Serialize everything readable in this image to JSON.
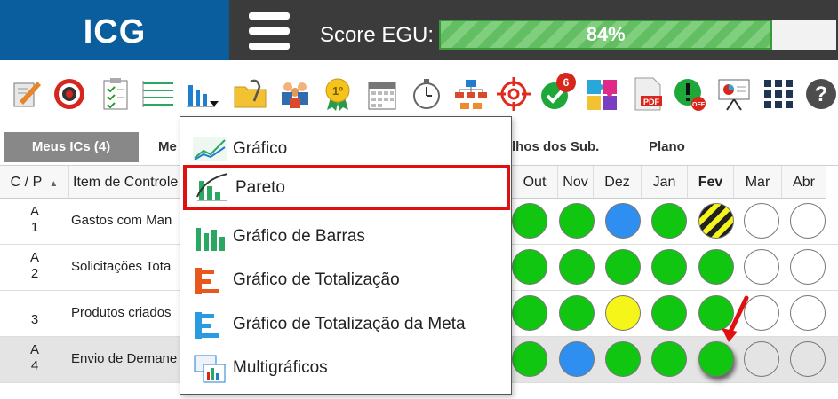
{
  "header": {
    "logo": "ICG",
    "score_label": "Score EGU:",
    "score_value": "84%",
    "score_fraction": 0.84
  },
  "toolbar": {
    "icons": [
      "edit-icon",
      "target-icon",
      "clipboard-checklist-icon",
      "lines-list-icon",
      "chart-dropdown-icon",
      "paperclip-folder-icon",
      "team-icon",
      "medal-icon",
      "calendar-icon",
      "stopwatch-icon",
      "org-chart-icon",
      "crosshair-icon",
      "approval-check-icon",
      "puzzle-icon",
      "pdf-icon",
      "alert-off-icon",
      "presentation-icon",
      "grid-icon",
      "help-icon"
    ],
    "badge_count": "6"
  },
  "tabs": [
    {
      "label": "Meus ICs (4)",
      "active": true
    },
    {
      "label": "Me"
    },
    {
      "label": "lhos dos Sub."
    },
    {
      "label": "Plano"
    }
  ],
  "table": {
    "headers": {
      "cp": "C / P",
      "item": "Item de Controle"
    },
    "months": [
      "Out",
      "Nov",
      "Dez",
      "Jan",
      "Fev",
      "Mar",
      "Abr"
    ],
    "current_month": "Fev",
    "rows": [
      {
        "cp1": "A",
        "cp2": "1",
        "item": "Gastos com Man",
        "status": [
          "green",
          "green",
          "blue",
          "green",
          "yellow-striped",
          "empty",
          "empty"
        ]
      },
      {
        "cp1": "A",
        "cp2": "2",
        "item": "Solicitações Tota",
        "status": [
          "green",
          "green",
          "green",
          "green",
          "green",
          "empty",
          "empty"
        ]
      },
      {
        "cp1": "",
        "cp2": "3",
        "item": "Produtos criados",
        "status": [
          "green",
          "green",
          "yellow",
          "green",
          "green",
          "empty",
          "empty"
        ]
      },
      {
        "cp1": "A",
        "cp2": "4",
        "item": "Envio de Demane",
        "status": [
          "green",
          "blue",
          "green",
          "green",
          "green",
          "empty",
          "empty"
        ]
      }
    ]
  },
  "dropdown": {
    "items": [
      {
        "label": "Gráfico",
        "icon": "line-chart-icon"
      },
      {
        "label": "Pareto",
        "icon": "pareto-chart-icon",
        "highlight": true
      },
      {
        "label": "Gráfico de Barras",
        "icon": "bar-chart-icon"
      },
      {
        "label": "Gráfico de Totalização",
        "icon": "totalization-chart-icon"
      },
      {
        "label": "Gráfico de Totalização da Meta",
        "icon": "goal-totalization-chart-icon"
      },
      {
        "label": "Multigráficos",
        "icon": "multi-chart-icon"
      }
    ]
  },
  "colors": {
    "green": "#11c611",
    "blue": "#2f8ff0",
    "yellow": "#f5f51a",
    "logo_bg": "#0b5e9e",
    "highlight": "#e01010"
  }
}
